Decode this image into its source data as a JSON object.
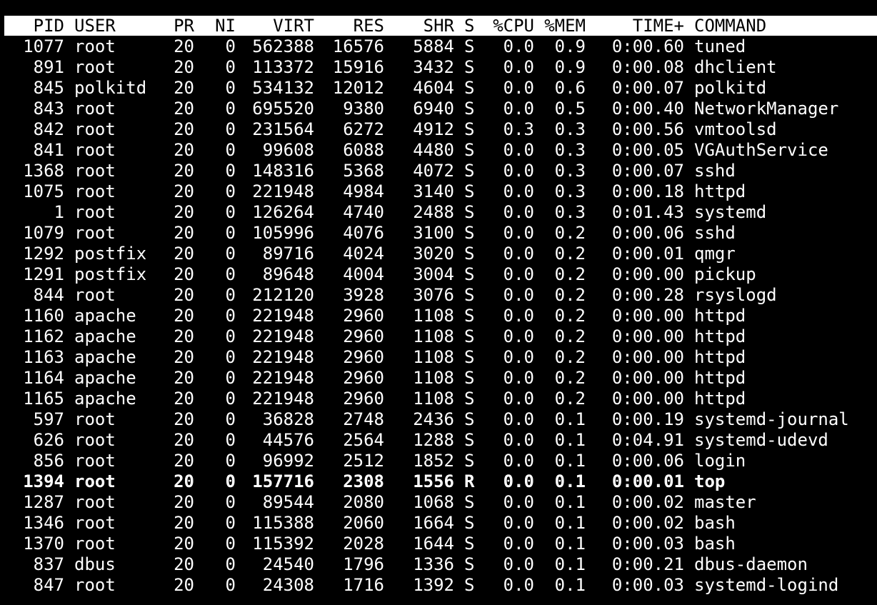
{
  "header": {
    "pid": "PID",
    "user": "USER",
    "pr": "PR",
    "ni": "NI",
    "virt": "VIRT",
    "res": "RES",
    "shr": "SHR",
    "s": "S",
    "cpu": "%CPU",
    "mem": "%MEM",
    "time": "TIME+",
    "command": "COMMAND"
  },
  "processes": [
    {
      "pid": "1077",
      "user": "root",
      "pr": "20",
      "ni": "0",
      "virt": "562388",
      "res": "16576",
      "shr": "5884",
      "s": "S",
      "cpu": "0.0",
      "mem": "0.9",
      "time": "0:00.60",
      "command": "tuned",
      "highlight": false
    },
    {
      "pid": "891",
      "user": "root",
      "pr": "20",
      "ni": "0",
      "virt": "113372",
      "res": "15916",
      "shr": "3432",
      "s": "S",
      "cpu": "0.0",
      "mem": "0.9",
      "time": "0:00.08",
      "command": "dhclient",
      "highlight": false
    },
    {
      "pid": "845",
      "user": "polkitd",
      "pr": "20",
      "ni": "0",
      "virt": "534132",
      "res": "12012",
      "shr": "4604",
      "s": "S",
      "cpu": "0.0",
      "mem": "0.6",
      "time": "0:00.07",
      "command": "polkitd",
      "highlight": false
    },
    {
      "pid": "843",
      "user": "root",
      "pr": "20",
      "ni": "0",
      "virt": "695520",
      "res": "9380",
      "shr": "6940",
      "s": "S",
      "cpu": "0.0",
      "mem": "0.5",
      "time": "0:00.40",
      "command": "NetworkManager",
      "highlight": false
    },
    {
      "pid": "842",
      "user": "root",
      "pr": "20",
      "ni": "0",
      "virt": "231564",
      "res": "6272",
      "shr": "4912",
      "s": "S",
      "cpu": "0.3",
      "mem": "0.3",
      "time": "0:00.56",
      "command": "vmtoolsd",
      "highlight": false
    },
    {
      "pid": "841",
      "user": "root",
      "pr": "20",
      "ni": "0",
      "virt": "99608",
      "res": "6088",
      "shr": "4480",
      "s": "S",
      "cpu": "0.0",
      "mem": "0.3",
      "time": "0:00.05",
      "command": "VGAuthService",
      "highlight": false
    },
    {
      "pid": "1368",
      "user": "root",
      "pr": "20",
      "ni": "0",
      "virt": "148316",
      "res": "5368",
      "shr": "4072",
      "s": "S",
      "cpu": "0.0",
      "mem": "0.3",
      "time": "0:00.07",
      "command": "sshd",
      "highlight": false
    },
    {
      "pid": "1075",
      "user": "root",
      "pr": "20",
      "ni": "0",
      "virt": "221948",
      "res": "4984",
      "shr": "3140",
      "s": "S",
      "cpu": "0.0",
      "mem": "0.3",
      "time": "0:00.18",
      "command": "httpd",
      "highlight": false
    },
    {
      "pid": "1",
      "user": "root",
      "pr": "20",
      "ni": "0",
      "virt": "126264",
      "res": "4740",
      "shr": "2488",
      "s": "S",
      "cpu": "0.0",
      "mem": "0.3",
      "time": "0:01.43",
      "command": "systemd",
      "highlight": false
    },
    {
      "pid": "1079",
      "user": "root",
      "pr": "20",
      "ni": "0",
      "virt": "105996",
      "res": "4076",
      "shr": "3100",
      "s": "S",
      "cpu": "0.0",
      "mem": "0.2",
      "time": "0:00.06",
      "command": "sshd",
      "highlight": false
    },
    {
      "pid": "1292",
      "user": "postfix",
      "pr": "20",
      "ni": "0",
      "virt": "89716",
      "res": "4024",
      "shr": "3020",
      "s": "S",
      "cpu": "0.0",
      "mem": "0.2",
      "time": "0:00.01",
      "command": "qmgr",
      "highlight": false
    },
    {
      "pid": "1291",
      "user": "postfix",
      "pr": "20",
      "ni": "0",
      "virt": "89648",
      "res": "4004",
      "shr": "3004",
      "s": "S",
      "cpu": "0.0",
      "mem": "0.2",
      "time": "0:00.00",
      "command": "pickup",
      "highlight": false
    },
    {
      "pid": "844",
      "user": "root",
      "pr": "20",
      "ni": "0",
      "virt": "212120",
      "res": "3928",
      "shr": "3076",
      "s": "S",
      "cpu": "0.0",
      "mem": "0.2",
      "time": "0:00.28",
      "command": "rsyslogd",
      "highlight": false
    },
    {
      "pid": "1160",
      "user": "apache",
      "pr": "20",
      "ni": "0",
      "virt": "221948",
      "res": "2960",
      "shr": "1108",
      "s": "S",
      "cpu": "0.0",
      "mem": "0.2",
      "time": "0:00.00",
      "command": "httpd",
      "highlight": false
    },
    {
      "pid": "1162",
      "user": "apache",
      "pr": "20",
      "ni": "0",
      "virt": "221948",
      "res": "2960",
      "shr": "1108",
      "s": "S",
      "cpu": "0.0",
      "mem": "0.2",
      "time": "0:00.00",
      "command": "httpd",
      "highlight": false
    },
    {
      "pid": "1163",
      "user": "apache",
      "pr": "20",
      "ni": "0",
      "virt": "221948",
      "res": "2960",
      "shr": "1108",
      "s": "S",
      "cpu": "0.0",
      "mem": "0.2",
      "time": "0:00.00",
      "command": "httpd",
      "highlight": false
    },
    {
      "pid": "1164",
      "user": "apache",
      "pr": "20",
      "ni": "0",
      "virt": "221948",
      "res": "2960",
      "shr": "1108",
      "s": "S",
      "cpu": "0.0",
      "mem": "0.2",
      "time": "0:00.00",
      "command": "httpd",
      "highlight": false
    },
    {
      "pid": "1165",
      "user": "apache",
      "pr": "20",
      "ni": "0",
      "virt": "221948",
      "res": "2960",
      "shr": "1108",
      "s": "S",
      "cpu": "0.0",
      "mem": "0.2",
      "time": "0:00.00",
      "command": "httpd",
      "highlight": false
    },
    {
      "pid": "597",
      "user": "root",
      "pr": "20",
      "ni": "0",
      "virt": "36828",
      "res": "2748",
      "shr": "2436",
      "s": "S",
      "cpu": "0.0",
      "mem": "0.1",
      "time": "0:00.19",
      "command": "systemd-journal",
      "highlight": false
    },
    {
      "pid": "626",
      "user": "root",
      "pr": "20",
      "ni": "0",
      "virt": "44576",
      "res": "2564",
      "shr": "1288",
      "s": "S",
      "cpu": "0.0",
      "mem": "0.1",
      "time": "0:04.91",
      "command": "systemd-udevd",
      "highlight": false
    },
    {
      "pid": "856",
      "user": "root",
      "pr": "20",
      "ni": "0",
      "virt": "96992",
      "res": "2512",
      "shr": "1852",
      "s": "S",
      "cpu": "0.0",
      "mem": "0.1",
      "time": "0:00.06",
      "command": "login",
      "highlight": false
    },
    {
      "pid": "1394",
      "user": "root",
      "pr": "20",
      "ni": "0",
      "virt": "157716",
      "res": "2308",
      "shr": "1556",
      "s": "R",
      "cpu": "0.0",
      "mem": "0.1",
      "time": "0:00.01",
      "command": "top",
      "highlight": true
    },
    {
      "pid": "1287",
      "user": "root",
      "pr": "20",
      "ni": "0",
      "virt": "89544",
      "res": "2080",
      "shr": "1068",
      "s": "S",
      "cpu": "0.0",
      "mem": "0.1",
      "time": "0:00.02",
      "command": "master",
      "highlight": false
    },
    {
      "pid": "1346",
      "user": "root",
      "pr": "20",
      "ni": "0",
      "virt": "115388",
      "res": "2060",
      "shr": "1664",
      "s": "S",
      "cpu": "0.0",
      "mem": "0.1",
      "time": "0:00.02",
      "command": "bash",
      "highlight": false
    },
    {
      "pid": "1370",
      "user": "root",
      "pr": "20",
      "ni": "0",
      "virt": "115392",
      "res": "2028",
      "shr": "1644",
      "s": "S",
      "cpu": "0.0",
      "mem": "0.1",
      "time": "0:00.03",
      "command": "bash",
      "highlight": false
    },
    {
      "pid": "837",
      "user": "dbus",
      "pr": "20",
      "ni": "0",
      "virt": "24540",
      "res": "1796",
      "shr": "1336",
      "s": "S",
      "cpu": "0.0",
      "mem": "0.1",
      "time": "0:00.21",
      "command": "dbus-daemon",
      "highlight": false
    },
    {
      "pid": "847",
      "user": "root",
      "pr": "20",
      "ni": "0",
      "virt": "24308",
      "res": "1716",
      "shr": "1392",
      "s": "S",
      "cpu": "0.0",
      "mem": "0.1",
      "time": "0:00.03",
      "command": "systemd-logind",
      "highlight": false
    }
  ],
  "colors": {
    "background": "#000000",
    "foreground": "#ffffff",
    "header_background": "#ffffff",
    "header_foreground": "#000000"
  }
}
